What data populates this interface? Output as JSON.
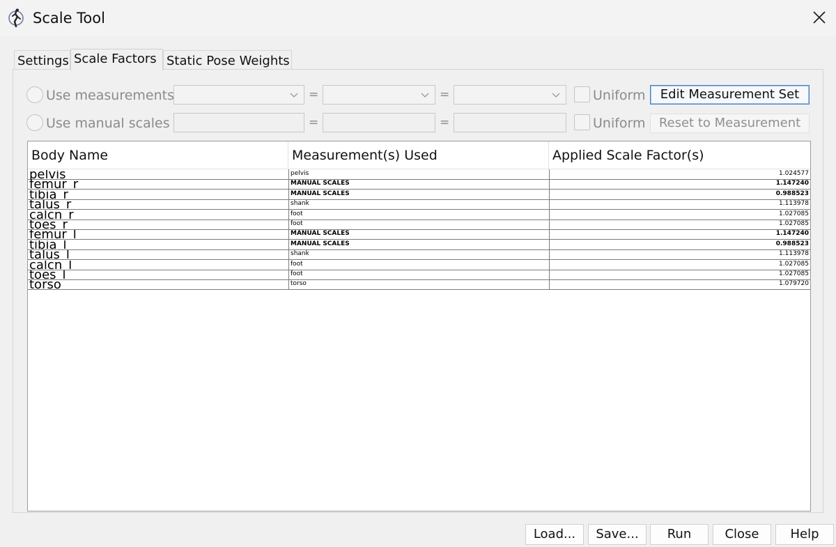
{
  "window": {
    "title": "Scale Tool"
  },
  "tabs": [
    {
      "label": "Settings"
    },
    {
      "label": "Scale Factors"
    },
    {
      "label": "Static Pose Weights"
    }
  ],
  "options": {
    "use_measurements_label": "Use measurements",
    "use_manual_scales_label": "Use manual scales",
    "equals": "=",
    "uniform_label": "Uniform",
    "edit_measurement_set_label": "Edit Measurement Set",
    "reset_to_measurement_label": "Reset to Measurement"
  },
  "table": {
    "columns": [
      "Body Name",
      "Measurement(s) Used",
      "Applied Scale Factor(s)"
    ],
    "rows": [
      {
        "body": "pelvis",
        "measurement": "pelvis",
        "factor": "1.024577",
        "manual": false
      },
      {
        "body": "femur_r",
        "measurement": "MANUAL SCALES",
        "factor": "1.147240",
        "manual": true
      },
      {
        "body": "tibia_r",
        "measurement": "MANUAL SCALES",
        "factor": "0.988523",
        "manual": true
      },
      {
        "body": "talus_r",
        "measurement": "shank",
        "factor": "1.113978",
        "manual": false
      },
      {
        "body": "calcn_r",
        "measurement": "foot",
        "factor": "1.027085",
        "manual": false
      },
      {
        "body": "toes_r",
        "measurement": "foot",
        "factor": "1.027085",
        "manual": false
      },
      {
        "body": "femur_l",
        "measurement": "MANUAL SCALES",
        "factor": "1.147240",
        "manual": true
      },
      {
        "body": "tibia_l",
        "measurement": "MANUAL SCALES",
        "factor": "0.988523",
        "manual": true
      },
      {
        "body": "talus_l",
        "measurement": "shank",
        "factor": "1.113978",
        "manual": false
      },
      {
        "body": "calcn_l",
        "measurement": "foot",
        "factor": "1.027085",
        "manual": false
      },
      {
        "body": "toes_l",
        "measurement": "foot",
        "factor": "1.027085",
        "manual": false
      },
      {
        "body": "torso",
        "measurement": "torso",
        "factor": "1.079720",
        "manual": false
      }
    ]
  },
  "buttons": {
    "load": "Load...",
    "save": "Save...",
    "run": "Run",
    "close": "Close",
    "help": "Help"
  },
  "colors": {
    "focus_border": "#4a7fc0",
    "table_bg": "#ffffff",
    "window_bg": "#f0f0f0"
  },
  "icons": {
    "app": "opensim-figure-icon",
    "close": "close-icon",
    "dropdown": "chevron-down-icon"
  }
}
